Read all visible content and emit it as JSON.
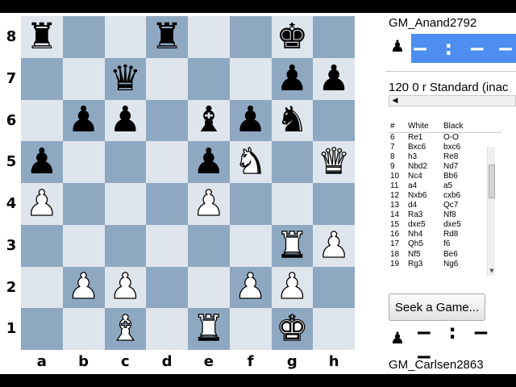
{
  "board": {
    "ranks": [
      "8",
      "7",
      "6",
      "5",
      "4",
      "3",
      "2",
      "1"
    ],
    "files": [
      "a",
      "b",
      "c",
      "d",
      "e",
      "f",
      "g",
      "h"
    ],
    "rows": [
      [
        {
          "p": "♜",
          "c": "b",
          "n": "black-rook-icon"
        },
        null,
        null,
        {
          "p": "♜",
          "c": "b",
          "n": "black-rook-icon"
        },
        null,
        null,
        {
          "p": "♚",
          "c": "b",
          "n": "black-king-icon"
        },
        null
      ],
      [
        null,
        null,
        {
          "p": "♛",
          "c": "b",
          "n": "black-queen-icon"
        },
        null,
        null,
        null,
        {
          "p": "♟",
          "c": "b",
          "n": "black-pawn-icon"
        },
        {
          "p": "♟",
          "c": "b",
          "n": "black-pawn-icon"
        }
      ],
      [
        null,
        {
          "p": "♟",
          "c": "b",
          "n": "black-pawn-icon"
        },
        {
          "p": "♟",
          "c": "b",
          "n": "black-pawn-icon"
        },
        null,
        {
          "p": "♝",
          "c": "b",
          "n": "black-bishop-icon"
        },
        {
          "p": "♟",
          "c": "b",
          "n": "black-pawn-icon"
        },
        {
          "p": "♞",
          "c": "b",
          "n": "black-knight-icon"
        },
        null
      ],
      [
        {
          "p": "♟",
          "c": "b",
          "n": "black-pawn-icon"
        },
        null,
        null,
        null,
        {
          "p": "♟",
          "c": "b",
          "n": "black-pawn-icon"
        },
        {
          "p": "♞",
          "c": "w",
          "n": "white-knight-icon"
        },
        null,
        {
          "p": "♛",
          "c": "w",
          "n": "white-queen-icon"
        }
      ],
      [
        {
          "p": "♟",
          "c": "w",
          "n": "white-pawn-icon"
        },
        null,
        null,
        null,
        {
          "p": "♟",
          "c": "w",
          "n": "white-pawn-icon"
        },
        null,
        null,
        null
      ],
      [
        null,
        null,
        null,
        null,
        null,
        null,
        {
          "p": "♜",
          "c": "w",
          "n": "white-rook-icon"
        },
        {
          "p": "♟",
          "c": "w",
          "n": "white-pawn-icon"
        }
      ],
      [
        null,
        {
          "p": "♟",
          "c": "w",
          "n": "white-pawn-icon"
        },
        {
          "p": "♟",
          "c": "w",
          "n": "white-pawn-icon"
        },
        null,
        null,
        {
          "p": "♟",
          "c": "w",
          "n": "white-pawn-icon"
        },
        {
          "p": "♟",
          "c": "w",
          "n": "white-pawn-icon"
        },
        null
      ],
      [
        null,
        null,
        {
          "p": "♝",
          "c": "w",
          "n": "white-bishop-icon"
        },
        null,
        {
          "p": "♜",
          "c": "w",
          "n": "white-rook-icon"
        },
        null,
        {
          "p": "♚",
          "c": "w",
          "n": "white-king-icon"
        },
        null
      ]
    ]
  },
  "top_player": {
    "name": "GM_Anand",
    "rating": "2792",
    "clock": "– : – –",
    "avatar_icon": "pawn-avatar-icon"
  },
  "bottom_player": {
    "name": "GM_Carlsen",
    "rating": "2863",
    "clock": "– : – –",
    "avatar_icon": "pawn-avatar-icon"
  },
  "game_info": "120 0 r Standard (inac",
  "moves": {
    "headers": [
      "#",
      "White",
      "Black"
    ],
    "rows": [
      [
        "6",
        "Re1",
        "O-O"
      ],
      [
        "7",
        "Bxc6",
        "bxc6"
      ],
      [
        "8",
        "h3",
        "Re8"
      ],
      [
        "9",
        "Nbd2",
        "Nd7"
      ],
      [
        "10",
        "Nc4",
        "Bb6"
      ],
      [
        "11",
        "a4",
        "a5"
      ],
      [
        "12",
        "Nxb6",
        "cxb6"
      ],
      [
        "13",
        "d4",
        "Qc7"
      ],
      [
        "14",
        "Ra3",
        "Nf8"
      ],
      [
        "15",
        "dxe5",
        "dxe5"
      ],
      [
        "16",
        "Nh4",
        "Rd8"
      ],
      [
        "17",
        "Qh5",
        "f6"
      ],
      [
        "18",
        "Nf5",
        "Be6"
      ],
      [
        "19",
        "Rg3",
        "Ng6"
      ]
    ]
  },
  "seek_button": "Seek a Game...",
  "colors": {
    "light_square": "#dfe5ec",
    "dark_square": "#8fa8c2",
    "active_clock": "#4d8ef0"
  }
}
